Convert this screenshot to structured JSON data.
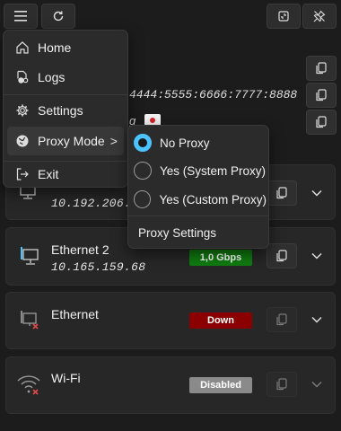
{
  "menu": {
    "items": [
      {
        "label": "Home",
        "icon": "home-icon"
      },
      {
        "label": "Logs",
        "icon": "logs-icon"
      },
      {
        "label": "Settings",
        "icon": "gear-icon"
      },
      {
        "label": "Proxy Mode",
        "icon": "globe-icon",
        "submenu_indicator": ">"
      },
      {
        "label": "Exit",
        "icon": "exit-icon"
      }
    ]
  },
  "proxy_menu": {
    "options": [
      {
        "label": "No Proxy",
        "selected": true
      },
      {
        "label": "Yes (System Proxy)",
        "selected": false
      },
      {
        "label": "Yes (Custom Proxy)",
        "selected": false
      }
    ],
    "settings_label": "Proxy Settings"
  },
  "background": {
    "ipv6_fragment": "4444:5555:6666:7777:8888",
    "fragment_text": "g"
  },
  "adapters": [
    {
      "name": "",
      "ip": "10.192.206.1",
      "status": ""
    },
    {
      "name": "Ethernet 2",
      "ip": "10.165.159.68",
      "status": "1,0 Gbps"
    },
    {
      "name": "Ethernet",
      "ip": "",
      "status": "Down"
    },
    {
      "name": "Wi-Fi",
      "ip": "",
      "status": "Disabled"
    }
  ],
  "colors": {
    "accent": "#4cc2ff",
    "status_up": "#107c10",
    "status_down": "#8b0000",
    "status_disabled": "#8a8a8a"
  }
}
